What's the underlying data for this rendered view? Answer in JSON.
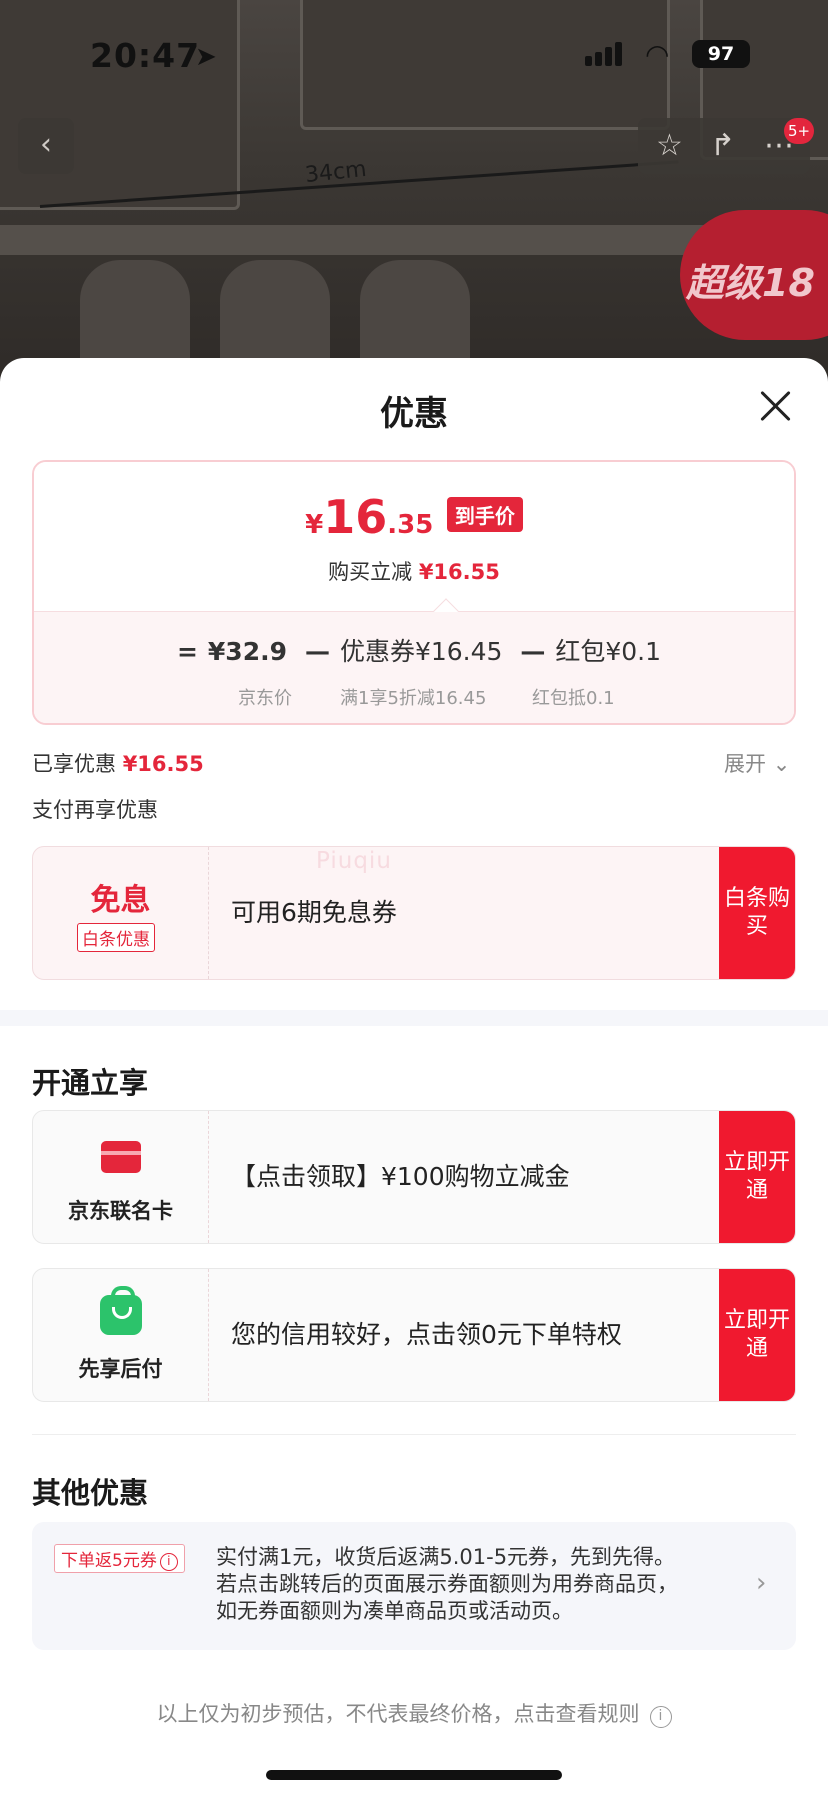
{
  "status_bar": {
    "time": "20:47",
    "battery": "97",
    "location_icon": "location-arrow-icon",
    "signal_icon": "signal-icon",
    "wifi_icon": "wifi-icon"
  },
  "product": {
    "dimension_label": "34cm",
    "promo_text": "超级18",
    "notification_count": "5+"
  },
  "sheet": {
    "title": "优惠",
    "price_card": {
      "currency": "¥",
      "price_int": "16",
      "price_dec": ".35",
      "final_tag": "到手价",
      "save_label": "购买立减",
      "save_amount": "¥16.55",
      "eq": "=",
      "base_price": "¥32.9",
      "base_label": "京东价",
      "coupon": "优惠券¥16.45",
      "coupon_label": "满1享5折减16.45",
      "redpack": "红包¥0.1",
      "redpack_label": "红包抵0.1",
      "minus": "—"
    },
    "enjoyed_label": "已享优惠",
    "enjoyed_amount": "¥16.55",
    "expand_label": "展开",
    "pay_more_label": "支付再享优惠",
    "baitiao": {
      "title": "免息",
      "tag": "白条优惠",
      "desc": "可用6期免息券",
      "cta": "白条购买"
    },
    "watermark": "Piuqiu",
    "open_section_title": "开通立享",
    "jd_card": {
      "name": "京东联名卡",
      "desc": "【点击领取】¥100购物立减金",
      "cta": "立即开通"
    },
    "pay_later": {
      "name": "先享后付",
      "desc": "您的信用较好，点击领0元下单特权",
      "cta": "立即开通"
    },
    "other_section_title": "其他优惠",
    "other": {
      "tag": "下单返5元券",
      "line1": "实付满1元，收货后返满5.01-5元券，先到先得。",
      "line2": "若点击跳转后的页面展示券面额则为用券商品页，",
      "line3": "如无券面额则为凑单商品页或活动页。"
    },
    "footer": "以上仅为初步预估，不代表最终价格，点击查看规则"
  },
  "colors": {
    "accent_red": "#e4263b",
    "cta_red": "#f0192f",
    "green": "#2cc36b"
  }
}
